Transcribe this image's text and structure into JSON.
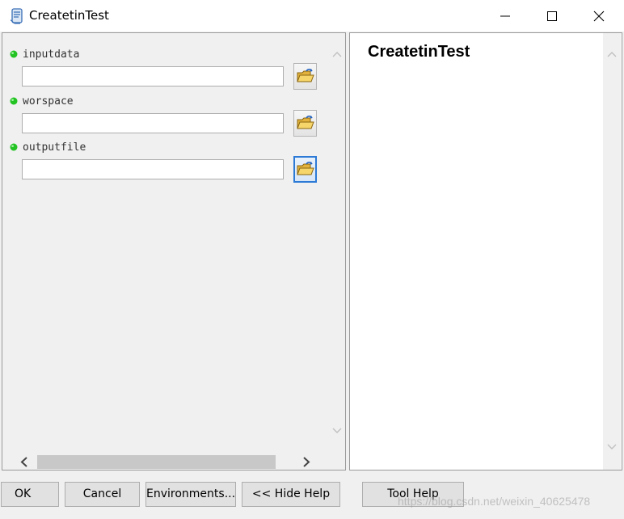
{
  "window": {
    "title": "CreatetinTest",
    "icon": "script-icon",
    "controls": [
      "minimize-icon",
      "maximize-icon",
      "close-icon"
    ]
  },
  "parameters": [
    {
      "label": "inputdata",
      "value": "",
      "browse_icon": "folder-open-icon"
    },
    {
      "label": "worspace",
      "value": "",
      "browse_icon": "folder-open-icon"
    },
    {
      "label": "outputfile",
      "value": "",
      "browse_icon": "folder-open-icon"
    }
  ],
  "help_panel": {
    "title": "CreatetinTest"
  },
  "buttons": {
    "ok": "OK",
    "cancel": "Cancel",
    "environments": "Environments...",
    "hide_help": "<< Hide Help",
    "tool_help": "Tool Help"
  },
  "watermark": "https://blog.csdn.net/weixin_40625478",
  "colors": {
    "required_dot": "#22c322",
    "focus_border": "#2d7ad6"
  }
}
